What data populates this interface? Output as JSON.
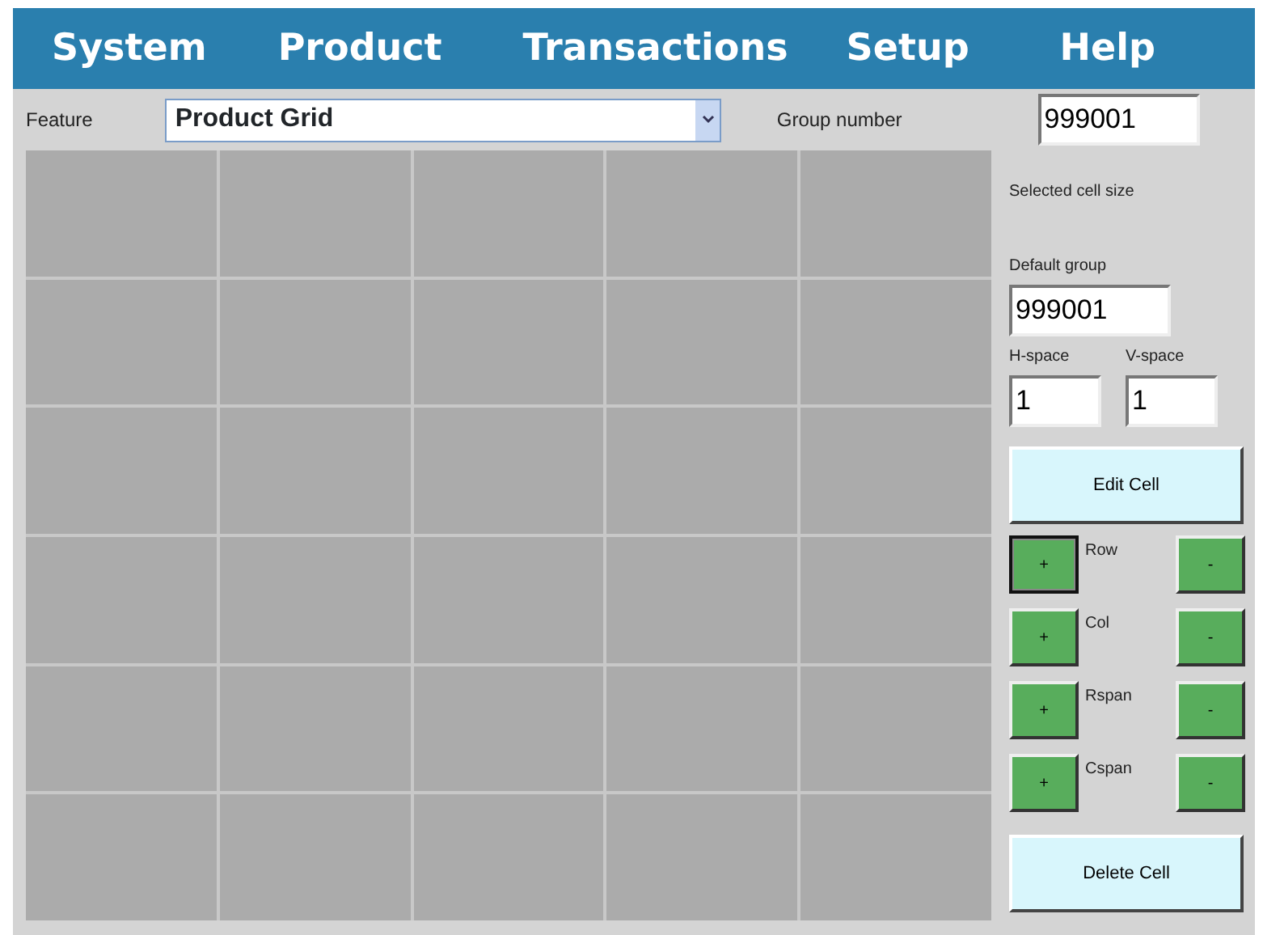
{
  "menu": [
    {
      "label": "System"
    },
    {
      "label": "Product"
    },
    {
      "label": "Transactions"
    },
    {
      "label": "Setup"
    },
    {
      "label": "Help"
    }
  ],
  "feature": {
    "label": "Feature",
    "value": "Product Grid"
  },
  "group_number": {
    "label": "Group number",
    "value": "999001"
  },
  "grid": {
    "rows": [
      {
        "cells": [
          {
            "kind": "empty"
          },
          {
            "kind": "empty"
          },
          {
            "kind": "empty"
          },
          {
            "kind": "empty"
          },
          {
            "kind": "empty"
          }
        ]
      },
      {
        "cells": [
          {
            "kind": "empty"
          },
          {
            "kind": "empty"
          },
          {
            "kind": "empty"
          },
          {
            "kind": "empty"
          },
          {
            "kind": "empty"
          }
        ]
      },
      {
        "cells": [
          {
            "kind": "empty"
          },
          {
            "kind": "empty"
          },
          {
            "kind": "empty"
          },
          {
            "kind": "empty"
          },
          {
            "kind": "empty"
          }
        ]
      },
      {
        "cells": [
          {
            "kind": "empty"
          },
          {
            "kind": "empty"
          },
          {
            "kind": "empty"
          },
          {
            "kind": "empty"
          },
          {
            "kind": "empty"
          }
        ]
      },
      {
        "cells": [
          {
            "kind": "empty"
          },
          {
            "kind": "empty"
          },
          {
            "kind": "empty"
          },
          {
            "kind": "empty"
          },
          {
            "kind": "empty"
          }
        ]
      },
      {
        "cells": [
          {
            "kind": "empty"
          },
          {
            "kind": "empty"
          },
          {
            "kind": "empty"
          },
          {
            "kind": "empty"
          },
          {
            "kind": "empty"
          }
        ]
      }
    ]
  },
  "selected_cell_size": {
    "label": "Selected cell size"
  },
  "default_group": {
    "label": "Default group",
    "value": "999001"
  },
  "h_space": {
    "label": "H-space",
    "value": "1"
  },
  "v_space": {
    "label": "V-space",
    "value": "1"
  },
  "edit_button": "Edit Cell",
  "adjusters": [
    {
      "label": "Row",
      "plus": "+",
      "minus": "-",
      "focused": true
    },
    {
      "label": "Col",
      "plus": "+",
      "minus": "-",
      "focused": false
    },
    {
      "label": "Rspan",
      "plus": "+",
      "minus": "-",
      "focused": false
    },
    {
      "label": "Cspan",
      "plus": "+",
      "minus": "-",
      "focused": false
    }
  ],
  "delete_button": "Delete Cell"
}
